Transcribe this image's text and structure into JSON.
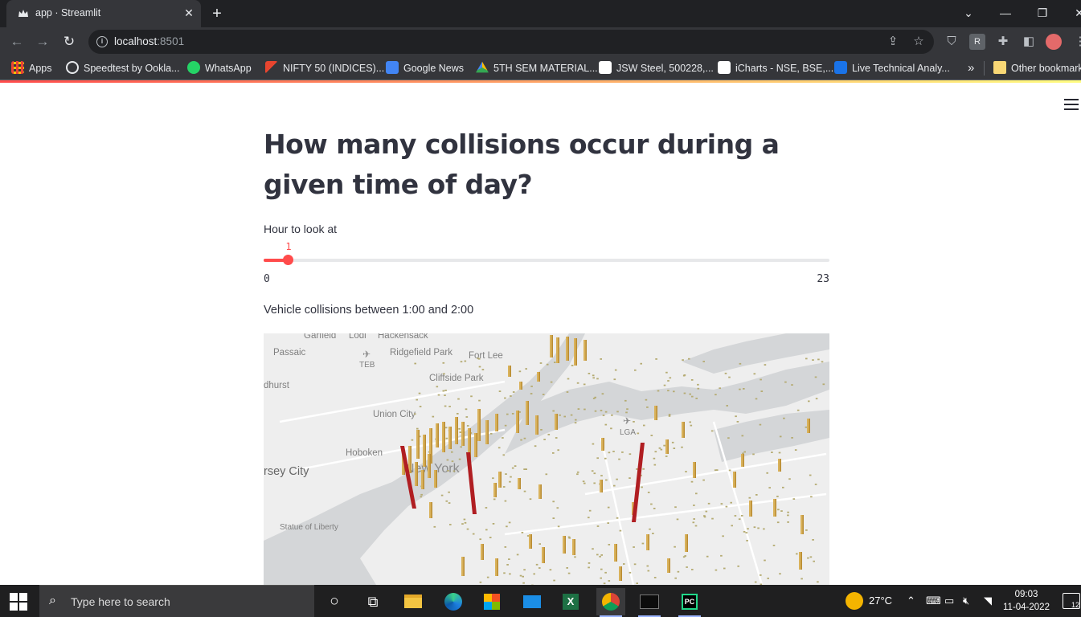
{
  "browser": {
    "tab_title": "app · Streamlit",
    "url_host": "localhost",
    "url_port": ":8501",
    "bookmarks": [
      {
        "label": "Apps",
        "icon": "apps-grid-icon"
      },
      {
        "label": "Speedtest by Ookla...",
        "icon": "speedtest-icon"
      },
      {
        "label": "WhatsApp",
        "icon": "whatsapp-icon"
      },
      {
        "label": "NIFTY 50 (INDICES)...",
        "icon": "nifty-icon"
      },
      {
        "label": "Google News",
        "icon": "google-news-icon"
      },
      {
        "label": "5TH SEM MATERIAL...",
        "icon": "google-drive-icon"
      },
      {
        "label": "JSW Steel, 500228,...",
        "icon": "jsw-icon"
      },
      {
        "label": "iCharts - NSE, BSE,...",
        "icon": "icharts-icon"
      },
      {
        "label": "Live Technical Analy...",
        "icon": "ci-icon"
      }
    ],
    "overflow_label": "»",
    "other_bookmarks": "Other bookmarks"
  },
  "page": {
    "faded_line": "",
    "heading": "How many collisions occur during a given time of day?",
    "slider": {
      "label": "Hour to look at",
      "value": "1",
      "min": "0",
      "max": "23",
      "accent": "#ff4b4b"
    },
    "caption": "Vehicle collisions between 1:00 and 2:00"
  },
  "map": {
    "labels": {
      "garfield": "Garfield",
      "lodi": "Lodi",
      "hackensack": "Hackensack",
      "passaic": "Passaic",
      "teb": "TEB",
      "ridgefield_park": "Ridgefield Park",
      "fort_lee": "Fort Lee",
      "cliffside_park": "Cliffside Park",
      "lyndhurst": "dhurst",
      "union_city": "Union City",
      "lga": "LGA",
      "hoboken": "Hoboken",
      "new_york": "New York",
      "jersey_city": "rsey City",
      "statue_of_liberty": "Statue of Liberty"
    },
    "colors": {
      "low": "#d9b25b",
      "high": "#b01e22",
      "dots": "#b5ab72",
      "land": "#f0f0f0",
      "water": "#d6d8da"
    }
  },
  "taskbar": {
    "search_placeholder": "Type here to search",
    "temperature": "27°C",
    "time": "09:03",
    "date": "11-04-2022",
    "notification_count": "12"
  }
}
